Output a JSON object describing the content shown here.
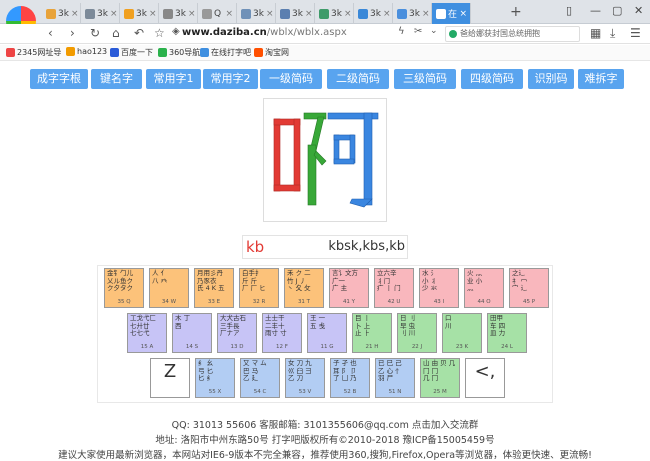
{
  "tabs": [
    {
      "label": "3k",
      "color": "#e8a33a"
    },
    {
      "label": "3k",
      "color": "#7c8a99"
    },
    {
      "label": "3k",
      "color": "#f0a020"
    },
    {
      "label": "3k",
      "color": "#888888"
    },
    {
      "label": "Q",
      "color": "#999999"
    },
    {
      "label": "3k",
      "color": "#6f91b8"
    },
    {
      "label": "3k",
      "color": "#5b7fb0"
    },
    {
      "label": "3k",
      "color": "#3e9b6a"
    },
    {
      "label": "3k",
      "color": "#3a88d8"
    },
    {
      "label": "3k",
      "color": "#4a8fdd"
    },
    {
      "label": "在",
      "color": "#ffffff"
    }
  ],
  "browser": {
    "new_tab": "+",
    "url_host": "www.daziba.cn",
    "url_path": "/wblx/wblx.aspx",
    "search_placeholder": "爸给娜获封国总统拥抱",
    "icons": [
      "back-icon",
      "forward-icon",
      "refresh-icon",
      "undo-icon",
      "star-icon",
      "shield-icon",
      "lightning-icon",
      "cut-icon",
      "chevron-down-icon",
      "grid-icon",
      "download-icon",
      "menu-icon"
    ]
  },
  "bookmarks": [
    {
      "label": "2345网址导",
      "color": "#e44"
    },
    {
      "label": "hao123",
      "color": "#f29b00"
    },
    {
      "label": "百度一下",
      "color": "#2a5bd8"
    },
    {
      "label": "360导航",
      "color": "#2bb24c"
    },
    {
      "label": "在线打字吧",
      "color": "#3f8fe0"
    },
    {
      "label": "淘宝网",
      "color": "#ff5000"
    }
  ],
  "menu": [
    "成字字根",
    "键名字",
    "常用字1",
    "常用字2",
    "一级简码",
    "二级简码",
    "三级简码",
    "四级简码",
    "识别码",
    "难拆字"
  ],
  "glyph": {
    "label": "啊"
  },
  "code": {
    "main": "kb",
    "alternates": "kbsk,kbs,kb"
  },
  "keyboard": {
    "row1": [
      {
        "radicals": "金钅勹儿\n乂ル鱼ク\nク夕タク",
        "code": "35 Q",
        "color": "orange"
      },
      {
        "radicals": "人 亻\n八 癶",
        "code": "34 W",
        "color": "orange"
      },
      {
        "radicals": "月用彡丹\n乃豕衣\n氏 4 K 五",
        "code": "33 E",
        "color": "orange"
      },
      {
        "radicals": "白手扌\n斤 斤\n厂 厂 ヒ",
        "code": "32 R",
        "color": "orange"
      },
      {
        "radicals": "禾 ク 二\n竹 J 丿\n丶 夂 攵",
        "code": "31 T",
        "color": "orange"
      },
      {
        "radicals": "言讠文方\n广一\n广 主",
        "code": "41 Y",
        "color": "pink"
      },
      {
        "radicals": "立六辛\n丬门\n疒 丨 门",
        "code": "42 U",
        "color": "pink"
      },
      {
        "radicals": "水 氵\n小 丬\n少 氺",
        "code": "43 I",
        "color": "pink"
      },
      {
        "radicals": "火 灬\n业 小\n灬",
        "code": "44 O",
        "color": "pink"
      },
      {
        "radicals": "之辶\n礻 冖\n宀 辶",
        "code": "45 P",
        "color": "pink"
      }
    ],
    "row2": [
      {
        "radicals": "工戈弋匚\n七廾廿\n七七弋",
        "code": "15 A",
        "color": "purple"
      },
      {
        "radicals": "木 丁\n西",
        "code": "14 S",
        "color": "purple"
      },
      {
        "radicals": "大犬古石\n三手長\n厂ナア",
        "code": "13 D",
        "color": "purple"
      },
      {
        "radicals": "土士干\n二丰十\n雨寸 寸",
        "code": "12 F",
        "color": "purple"
      },
      {
        "radicals": "王 一\n五 戋",
        "code": "11 G",
        "color": "purple"
      },
      {
        "radicals": "目 丨\n卜 上\n止 ⺊",
        "code": "21 H",
        "color": "green"
      },
      {
        "radicals": "日 刂\n早 虫\n刂 川",
        "code": "22 J",
        "color": "green"
      },
      {
        "radicals": "口\n川",
        "code": "23 K",
        "color": "green"
      },
      {
        "radicals": "田甲\n车 四\n皿 力",
        "code": "24 L",
        "color": "green"
      }
    ],
    "row3": [
      {
        "radicals": "Z",
        "code": "",
        "color": "plain",
        "big": true
      },
      {
        "radicals": "纟 幺\n弓 匕\n匕 纟",
        "code": "55 X",
        "color": "blue"
      },
      {
        "radicals": "又 マ ム\n巴 马\n乙 廴",
        "code": "54 C",
        "color": "blue"
      },
      {
        "radicals": "女 刀 九\n巛 臼 彐\n乙 刀",
        "code": "53 V",
        "color": "blue"
      },
      {
        "radicals": "子 孑 也\n耳 阝 卩\n了 凵 乃",
        "code": "52 B",
        "color": "blue"
      },
      {
        "radicals": "已 巳 己\n乙 心 忄\n羽 尸",
        "code": "51 N",
        "color": "blue"
      },
      {
        "radicals": "山 由 贝 几\n冂 冂\n几 冂",
        "code": "25 M",
        "color": "green"
      },
      {
        "radicals": "<,",
        "code": "",
        "color": "plain",
        "big": true
      }
    ]
  },
  "footer": {
    "line1": "QQ: 31013 55606 客服邮箱: 3101355606@qq.com 点击加入交流群",
    "line2": "地址: 洛阳市中州东路50号 打字吧版权所有©2010-2018 豫ICP备15005459号",
    "line3": "建议大家使用最新浏览器，本网站对IE6-9版本不完全兼容，推荐使用360,搜狗,Firefox,Opera等浏览器，体验更快速、更流畅!"
  }
}
